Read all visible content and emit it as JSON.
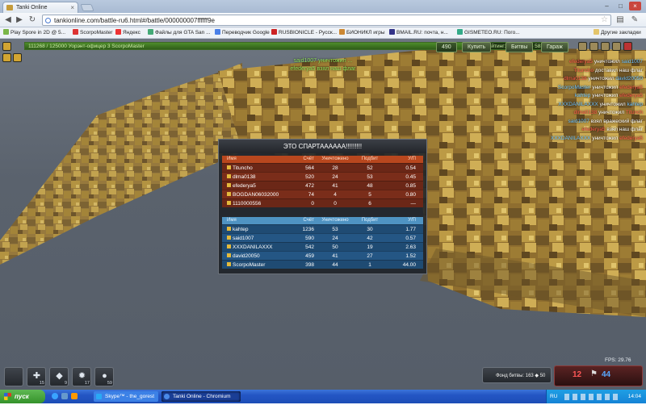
{
  "browser": {
    "tab_title": "Tanki Online",
    "url": "tankionline.com/battle-ru6.html#/battle/000000007ffffff9e",
    "bookmarks": [
      {
        "label": "Play Spore in 2D @ 5...",
        "color": "#7ab648"
      },
      {
        "label": "ScorpoMaster",
        "color": "#d33"
      },
      {
        "label": "Яндекс",
        "color": "#e33"
      },
      {
        "label": "Файлы для GTA San ...",
        "color": "#4a7"
      },
      {
        "label": "Переводчик Google",
        "color": "#4a80e8"
      },
      {
        "label": "RUSBIONICLE - Русск...",
        "color": "#c22"
      },
      {
        "label": "БИОНИКЛ игры",
        "color": "#c83"
      },
      {
        "label": "ВМАIL.RU: почта, н...",
        "color": "#338"
      },
      {
        "label": "GISMETEO.RU: Пого...",
        "color": "#3a8"
      }
    ],
    "other_bookmarks": "Другие закладки"
  },
  "hud": {
    "progress_left": "111268 / 125000  Уорэнт-офицер 3 ScorpoMaster",
    "progress_right": "Рейтинг: 8146199  ◆ 583",
    "crystals": "490",
    "buy_label": "Купить",
    "battles_label": "Битвы",
    "garage_label": "Гараж",
    "top_messages": [
      "said1007 уничтожил ...",
      "efederya5 взял наш флаг"
    ]
  },
  "killfeed": [
    {
      "a": "efederya5",
      "v": "уничтожил",
      "b": "said1007"
    },
    {
      "a": "Tituncho",
      "v": "доставил наш флаг",
      "b": ""
    },
    {
      "a": "dlma0138",
      "v": "уничтожил",
      "b": "david20050"
    },
    {
      "a": "ScorpoMaster",
      "v": "уничтожил",
      "b": "efederya5"
    },
    {
      "a": "kahtep",
      "v": "уничтожил",
      "b": "efederya5"
    },
    {
      "a": "XXXDANILAXXX",
      "v": "уничтожил",
      "b": "kahtep"
    },
    {
      "a": "dlma0138",
      "v": "уничтожил",
      "b": "Titunch"
    },
    {
      "a": "said1007",
      "v": "взял вражеский флаг",
      "b": ""
    },
    {
      "a": "efederya5",
      "v": "взял наш флаг",
      "b": ""
    },
    {
      "a": "XXXDANILAXXX",
      "v": "уничтожил",
      "b": "efederya5"
    }
  ],
  "scoreboard": {
    "title": "ЭТО СПАРТАААААА!!!!!!!!!",
    "headers": [
      "Имя",
      "Счёт",
      "Уничтожено",
      "Подбит",
      "У/П"
    ],
    "red_team": [
      {
        "name": "Titunchо",
        "score": "564",
        "kills": "28",
        "deaths": "52",
        "ratio": "0.54"
      },
      {
        "name": "dlma0138",
        "score": "520",
        "kills": "24",
        "deaths": "53",
        "ratio": "0.45"
      },
      {
        "name": "efederya5",
        "score": "472",
        "kills": "41",
        "deaths": "48",
        "ratio": "0.85"
      },
      {
        "name": "BOGDAN06032000",
        "score": "74",
        "kills": "4",
        "deaths": "5",
        "ratio": "0.80"
      },
      {
        "name": "1110000556",
        "score": "0",
        "kills": "0",
        "deaths": "6",
        "ratio": "—"
      }
    ],
    "blue_team": [
      {
        "name": "kahtep",
        "score": "1236",
        "kills": "53",
        "deaths": "30",
        "ratio": "1.77"
      },
      {
        "name": "said1007",
        "score": "590",
        "kills": "24",
        "deaths": "42",
        "ratio": "0.57"
      },
      {
        "name": "XXXDANILAXXX",
        "score": "542",
        "kills": "50",
        "deaths": "19",
        "ratio": "2.63"
      },
      {
        "name": "david20050",
        "score": "459",
        "kills": "41",
        "deaths": "27",
        "ratio": "1.52"
      },
      {
        "name": "ScorpoMaster",
        "score": "398",
        "kills": "44",
        "deaths": "1",
        "ratio": "44.00"
      }
    ]
  },
  "bottom": {
    "slots": [
      "",
      "15",
      "9",
      "17",
      "59"
    ],
    "fund": "Фонд битвы: 163 ◆",
    "fund_players": "50",
    "fps": "FPS:  29.76",
    "red_flags": "12",
    "blue_flags": "44"
  },
  "taskbar": {
    "start": "пуск",
    "items": [
      "Skype™ - the_gorest",
      "Tanki Online - Chromium"
    ],
    "lang": "RU",
    "clock": "14:04"
  }
}
